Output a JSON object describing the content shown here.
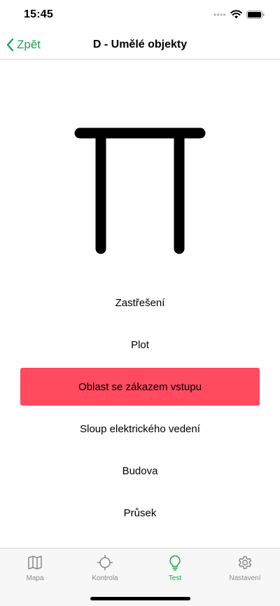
{
  "status": {
    "time": "15:45"
  },
  "nav": {
    "back_label": "Zpět",
    "title": "D - Umělé objekty"
  },
  "options": [
    {
      "label": "Zastřešení",
      "selected": false
    },
    {
      "label": "Plot",
      "selected": false
    },
    {
      "label": "Oblast se zákazem vstupu",
      "selected": true
    },
    {
      "label": "Sloup elektrického vedení",
      "selected": false
    },
    {
      "label": "Budova",
      "selected": false
    },
    {
      "label": "Průsek",
      "selected": false
    }
  ],
  "tabs": [
    {
      "label": "Mapa",
      "icon": "map-icon",
      "active": false
    },
    {
      "label": "Kontrola",
      "icon": "crosshair-icon",
      "active": false
    },
    {
      "label": "Test",
      "icon": "lightbulb-icon",
      "active": true
    },
    {
      "label": "Nastavení",
      "icon": "gear-icon",
      "active": false
    }
  ],
  "colors": {
    "accent": "#1fa252",
    "selected": "#ff4a60",
    "inactive": "#8a8a8a"
  }
}
